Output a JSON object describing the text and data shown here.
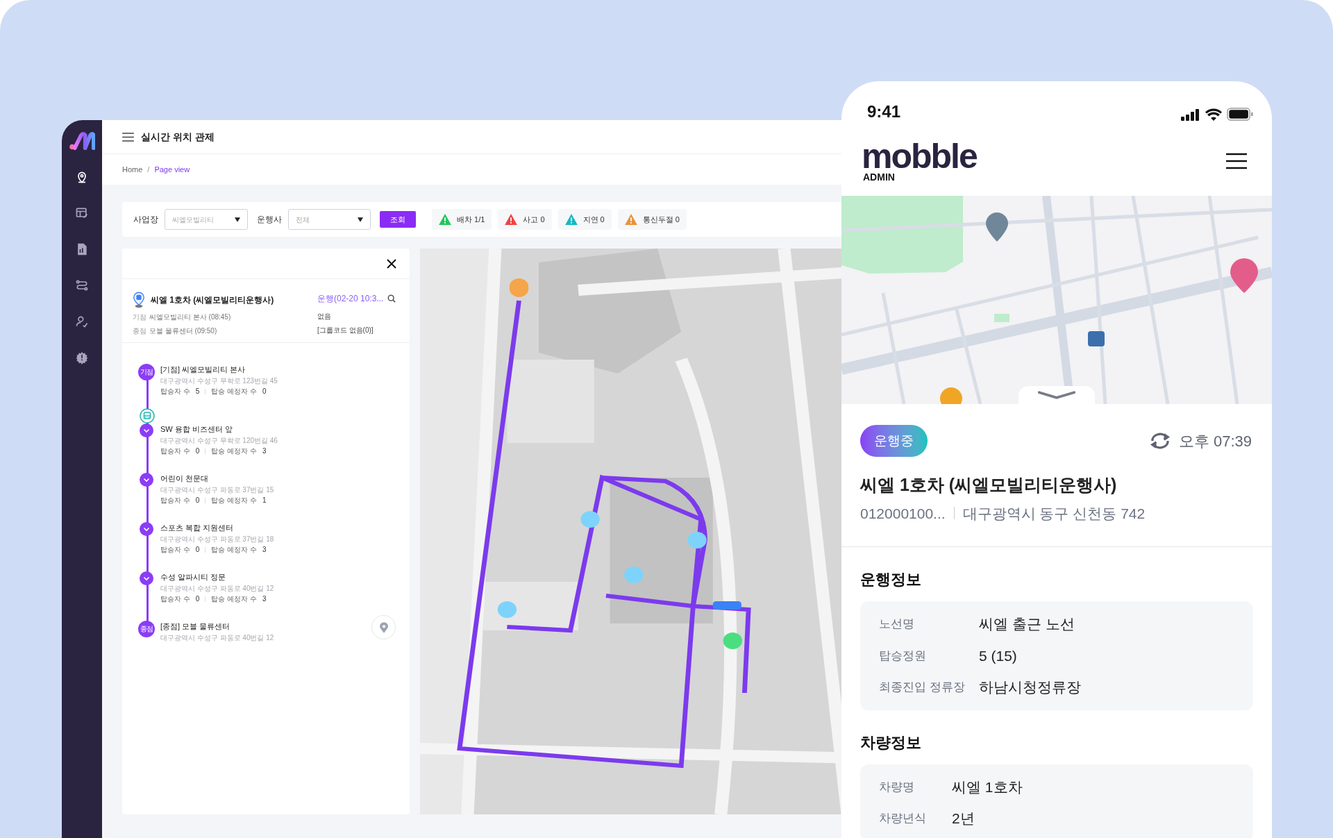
{
  "sidebar": {
    "items": [
      {
        "kind": "pin",
        "selected": true
      },
      {
        "kind": "board",
        "selected": false
      },
      {
        "kind": "document",
        "selected": false
      },
      {
        "kind": "route",
        "selected": false
      },
      {
        "kind": "person",
        "selected": false
      },
      {
        "kind": "gear",
        "selected": false
      }
    ]
  },
  "header": {
    "title": "실시간 위치 관제"
  },
  "breadcrumb": [
    {
      "label": "Home",
      "selected": false
    },
    {
      "separator": "/",
      "label": "Page view",
      "selected": true
    }
  ],
  "filters": {
    "site_label": "사업장",
    "site_value": "씨엘모빌리티",
    "operator_label": "운행사",
    "operator_value": "전체",
    "search_button": "조회",
    "chips": [
      {
        "label": "배차 1/1",
        "color": "#22c55e"
      },
      {
        "label": "사고 0",
        "color": "#ef4444"
      },
      {
        "label": "지연 0",
        "color": "#14b8c4"
      },
      {
        "label": "통신두절 0",
        "color": "#e8943a"
      }
    ]
  },
  "vehicle_panel": {
    "title": "씨엘 1호차 (씨엘모빌리티운행사)",
    "status": "운행(02-20 10:3...",
    "start_label": "기점",
    "start": "씨엘모빌리티 본사 (08:45)",
    "end_label": "종점",
    "end": "모블 물류센터 (09:50)",
    "note": "없음",
    "group": "[그룹코드 없음(0)]",
    "stops": [
      {
        "kind": "start",
        "marker": "기점",
        "name": "[기점] 씨엘모빌리티 본사",
        "address": "대구광역시 수성구 무학로 123번길 45",
        "riders_label": "탑승자 수",
        "riders": "5",
        "expected_label": "탑승 예정자 수",
        "expected": "0"
      },
      {
        "kind": "vehicle"
      },
      {
        "kind": "stop",
        "name": "SW 융합 비즈센터 앞",
        "address": "대구광역시 수성구 무학로 120번길 46",
        "riders_label": "탑승자 수",
        "riders": "0",
        "expected_label": "탑승 예정자 수",
        "expected": "3"
      },
      {
        "kind": "stop",
        "name": "어린이 천문대",
        "address": "대구광역시 수성구 파동로 37번길 15",
        "riders_label": "탑승자 수",
        "riders": "0",
        "expected_label": "탑승 예정자 수",
        "expected": "1"
      },
      {
        "kind": "stop",
        "name": "스포츠 복합 지원센터",
        "address": "대구광역시 수성구 파동로 37번길 18",
        "riders_label": "탑승자 수",
        "riders": "0",
        "expected_label": "탑승 예정자 수",
        "expected": "3"
      },
      {
        "kind": "stop",
        "name": "수성 알파시티 정문",
        "address": "대구광역시 수성구 파동로 40번길 12",
        "riders_label": "탑승자 수",
        "riders": "0",
        "expected_label": "탑승 예정자 수",
        "expected": "3"
      },
      {
        "kind": "end",
        "marker": "종점",
        "name": "[종점] 모블 물류센터",
        "address": "대구광역시 수성구 파동로 40번길 12"
      }
    ]
  },
  "phone": {
    "time": "9:41",
    "logo": "mobble",
    "logo_sub": "ADMIN",
    "status_badge": "운행중",
    "updated": "오후 07:39",
    "title": "씨엘 1호차 (씨엘모빌리티운행사)",
    "device_id": "012000100...",
    "address": "대구광역시 동구 신천동 742",
    "sections": [
      {
        "title": "운행정보",
        "rows": [
          {
            "label": "노선명",
            "value": "씨엘 출근 노선"
          },
          {
            "label": "탑승정원",
            "value": "5 (15)"
          },
          {
            "label": "최종진입 정류장",
            "value": "하남시청정류장"
          }
        ]
      },
      {
        "title": "차량정보",
        "rows": [
          {
            "label": "차량명",
            "value": "씨엘 1호차"
          },
          {
            "label": "차량년식",
            "value": "2년"
          }
        ]
      }
    ]
  }
}
